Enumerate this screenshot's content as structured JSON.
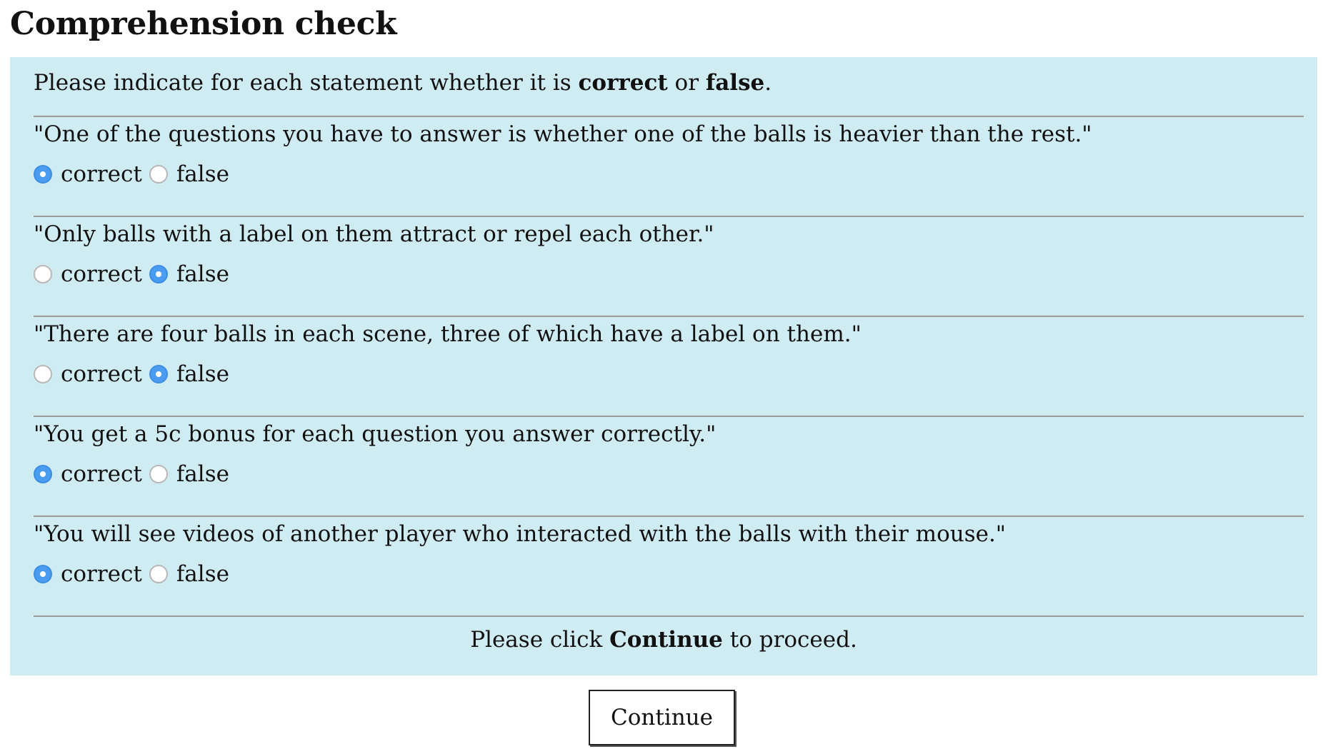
{
  "page": {
    "title": "Comprehension check"
  },
  "instructions": {
    "prefix": "Please indicate for each statement whether it is ",
    "word_correct": "correct",
    "middle": " or ",
    "word_false": "false",
    "suffix": "."
  },
  "option_labels": {
    "correct": "correct",
    "false": "false"
  },
  "questions": [
    {
      "statement": "\"One of the questions you have to answer is whether one of the balls is heavier than the rest.\"",
      "selected": "correct"
    },
    {
      "statement": "\"Only balls with a label on them attract or repel each other.\"",
      "selected": "false"
    },
    {
      "statement": "\"There are four balls in each scene, three of which have a label on them.\"",
      "selected": "false"
    },
    {
      "statement": "\"You get a 5c bonus for each question you answer correctly.\"",
      "selected": "correct"
    },
    {
      "statement": "\"You will see videos of another player who interacted with the balls with their mouse.\"",
      "selected": "correct"
    }
  ],
  "footer": {
    "prefix": "Please click ",
    "bold": "Continue",
    "suffix": " to proceed."
  },
  "continue_button": {
    "label": "Continue"
  },
  "colors": {
    "panel_background": "#d0ecf3",
    "radio_selected": "#4a9cf1",
    "divider": "#9a9a9a"
  }
}
